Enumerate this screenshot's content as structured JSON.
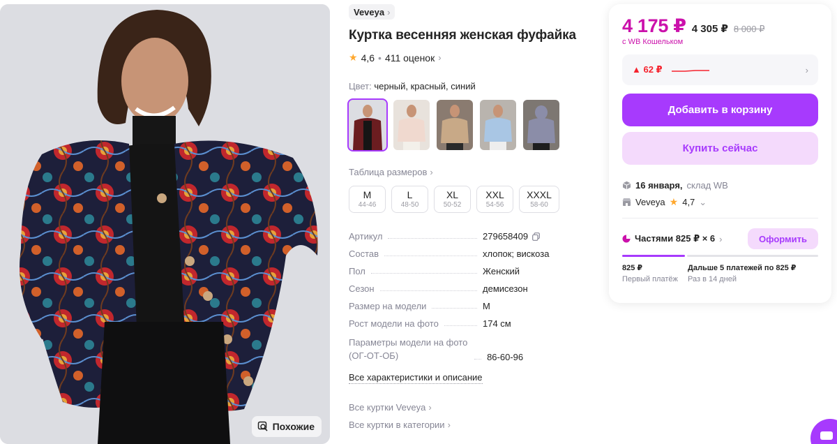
{
  "photo": {
    "similar_label": "Похожие"
  },
  "product": {
    "brand": "Veveya",
    "title": "Куртка весенняя женская фуфайка",
    "rating": "4,6",
    "reviews": "411 оценок",
    "color_label": "Цвет:",
    "color_value": "черный, красный, синий",
    "size_table_label": "Таблица размеров",
    "sizes": [
      {
        "size": "M",
        "range": "44-46"
      },
      {
        "size": "L",
        "range": "48-50"
      },
      {
        "size": "XL",
        "range": "50-52"
      },
      {
        "size": "XXL",
        "range": "54-56"
      },
      {
        "size": "XXXL",
        "range": "58-60"
      }
    ],
    "specs": [
      {
        "key": "Артикул",
        "value": "279658409"
      },
      {
        "key": "Состав",
        "value": "хлопок; вискоза"
      },
      {
        "key": "Пол",
        "value": "Женский"
      },
      {
        "key": "Сезон",
        "value": "демисезон"
      },
      {
        "key": "Размер на модели",
        "value": "M"
      },
      {
        "key": "Рост модели на фото",
        "value": "174 см"
      },
      {
        "key": "Параметры модели на фото (ОГ-ОТ-ОБ)",
        "value": "86-60-96"
      }
    ],
    "all_chars_label": "Все характеристики и описание",
    "all_brand_link": "Все куртки Veveya",
    "all_category_link": "Все куртки в категории"
  },
  "card": {
    "price_main": "4 175 ₽",
    "price_secondary": "4 305 ₽",
    "price_old": "8 000 ₽",
    "wallet_label": "с WB Кошельком",
    "price_change": "▲ 62 ₽",
    "add_to_cart": "Добавить в корзину",
    "buy_now": "Купить сейчас",
    "delivery_date": "16 января,",
    "delivery_place": "склад WB",
    "seller": "Veveya",
    "seller_rating": "4,7",
    "installments": "Частями 825 ₽ × 6",
    "installments_button": "Оформить",
    "first_amount": "825 ₽",
    "first_label": "Первый платёж",
    "next_amount": "Дальше 5 платежей по 825 ₽",
    "next_label": "Раз в 14 дней"
  },
  "colors": {
    "accent": "#a73afd",
    "price": "#cb11ab",
    "price_up": "#f5222d",
    "star": "#ffa82e"
  },
  "icons": [
    "similar-search-icon",
    "chevron-right-icon",
    "star-icon",
    "copy-icon",
    "box-icon",
    "shop-icon",
    "pie-icon",
    "chat-icon"
  ]
}
